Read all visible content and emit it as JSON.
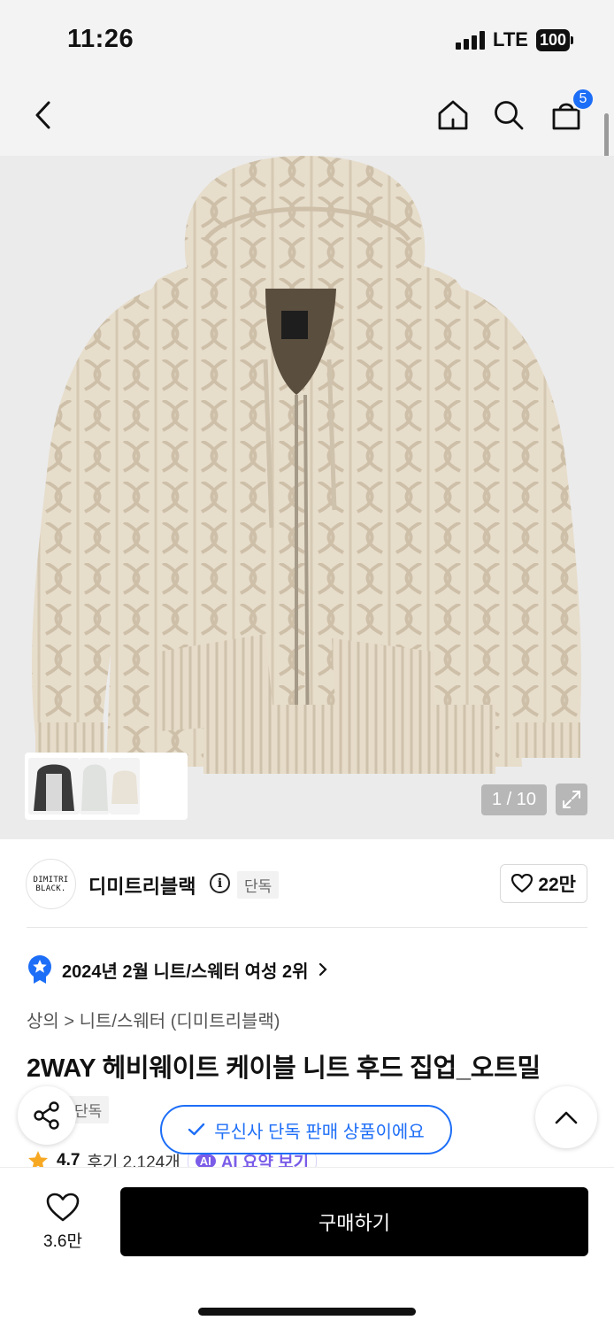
{
  "status_bar": {
    "time": "11:26",
    "network": "LTE",
    "battery": "100"
  },
  "nav": {
    "cart_count": "5",
    "icons": [
      "back-icon",
      "home-icon",
      "search-icon",
      "cart-icon"
    ]
  },
  "gallery": {
    "counter": "1 / 10",
    "icons": [
      "expand-icon"
    ],
    "image_subject": "beige cable knit hooded zip-up sweater",
    "thumbnail_colors": [
      "#3a3a3a",
      "#dfe2df",
      "#e9e2d6"
    ]
  },
  "brand": {
    "logo_line1": "DIMITRI",
    "logo_line2": "BLACK.",
    "name": "디미트리블랙",
    "exclusive_tag": "단독",
    "likes": "22만"
  },
  "ranking": {
    "text": "2024년 2월 니트/스웨터 여성 2위"
  },
  "breadcrumb": {
    "level1": "상의",
    "level2": "니트/스웨터 (디미트리블랙)"
  },
  "product": {
    "title": "2WAY 헤비웨이트 케이블 니트 후드 집업_오트밀",
    "exclusive_tag": "단독",
    "rating": "4.7",
    "review_count": "후기 2,124개",
    "ai_badge": "AI",
    "ai_summary": "AI 요약 보기"
  },
  "floating": {
    "exclusive_banner": "무신사 단독 판매 상품이에요"
  },
  "bottom": {
    "like_count": "3.6만",
    "buy_label": "구매하기"
  },
  "colors": {
    "accent_blue": "#1d6ef7",
    "ai_purple": "#7a5ce8",
    "buy_button": "#000000",
    "sweater": "#e6dcc9"
  }
}
